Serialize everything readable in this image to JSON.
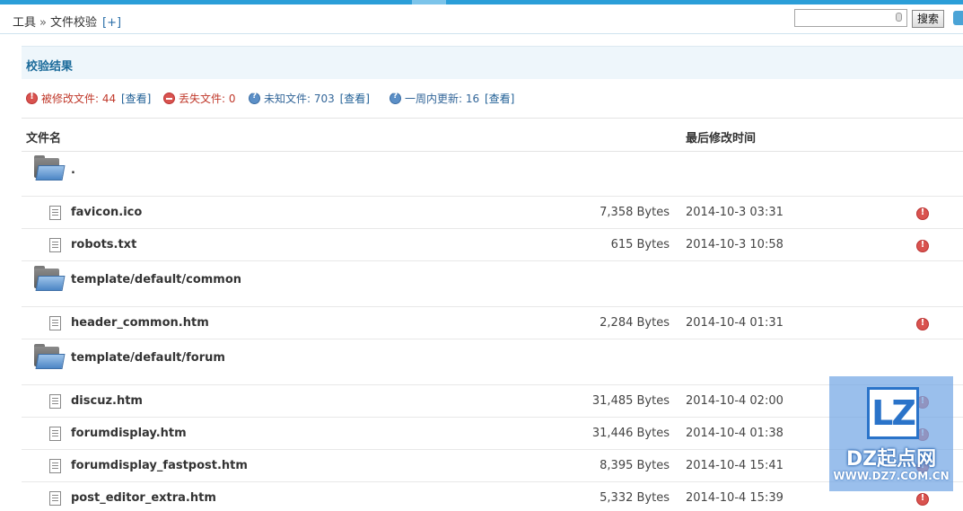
{
  "breadcrumb": {
    "tools": "工具",
    "separator": "»",
    "current": "文件校验",
    "add": "[+]"
  },
  "search": {
    "placeholder": "",
    "button": "搜索"
  },
  "panel": {
    "title": "校验结果"
  },
  "summary": {
    "modified_label": "被修改文件: 44",
    "modified_link": "[查看]",
    "lost_label": "丢失文件: 0",
    "unknown_label": "未知文件: 703",
    "unknown_link": "[查看]",
    "week_label": "一周内更新: 16",
    "week_link": "[查看]"
  },
  "table": {
    "col_name": "文件名",
    "col_time": "最后修改时间",
    "rows": [
      {
        "type": "folder",
        "name": "."
      },
      {
        "type": "file",
        "name": "favicon.ico",
        "size": "7,358 Bytes",
        "date": "2014-10-3 03:31",
        "status": "modified"
      },
      {
        "type": "file",
        "name": "robots.txt",
        "size": "615 Bytes",
        "date": "2014-10-3 10:58",
        "status": "modified"
      },
      {
        "type": "folder",
        "name": "template/default/common"
      },
      {
        "type": "file",
        "name": "header_common.htm",
        "size": "2,284 Bytes",
        "date": "2014-10-4 01:31",
        "status": "modified"
      },
      {
        "type": "folder",
        "name": "template/default/forum"
      },
      {
        "type": "file",
        "name": "discuz.htm",
        "size": "31,485 Bytes",
        "date": "2014-10-4 02:00",
        "status": "modified"
      },
      {
        "type": "file",
        "name": "forumdisplay.htm",
        "size": "31,446 Bytes",
        "date": "2014-10-4 01:38",
        "status": "modified"
      },
      {
        "type": "file",
        "name": "forumdisplay_fastpost.htm",
        "size": "8,395 Bytes",
        "date": "2014-10-4 15:41",
        "status": "modified"
      },
      {
        "type": "file",
        "name": "post_editor_extra.htm",
        "size": "5,332 Bytes",
        "date": "2014-10-4 15:39",
        "status": "modified"
      }
    ]
  },
  "watermark": {
    "logo": "LZ",
    "name": "DZ起点网",
    "url": "WWW.DZ7.COM.CN"
  },
  "colors": {
    "accent": "#2b9ed8",
    "title": "#1a6a9a",
    "alert": "#d9534f",
    "info": "#5b8fc7"
  }
}
